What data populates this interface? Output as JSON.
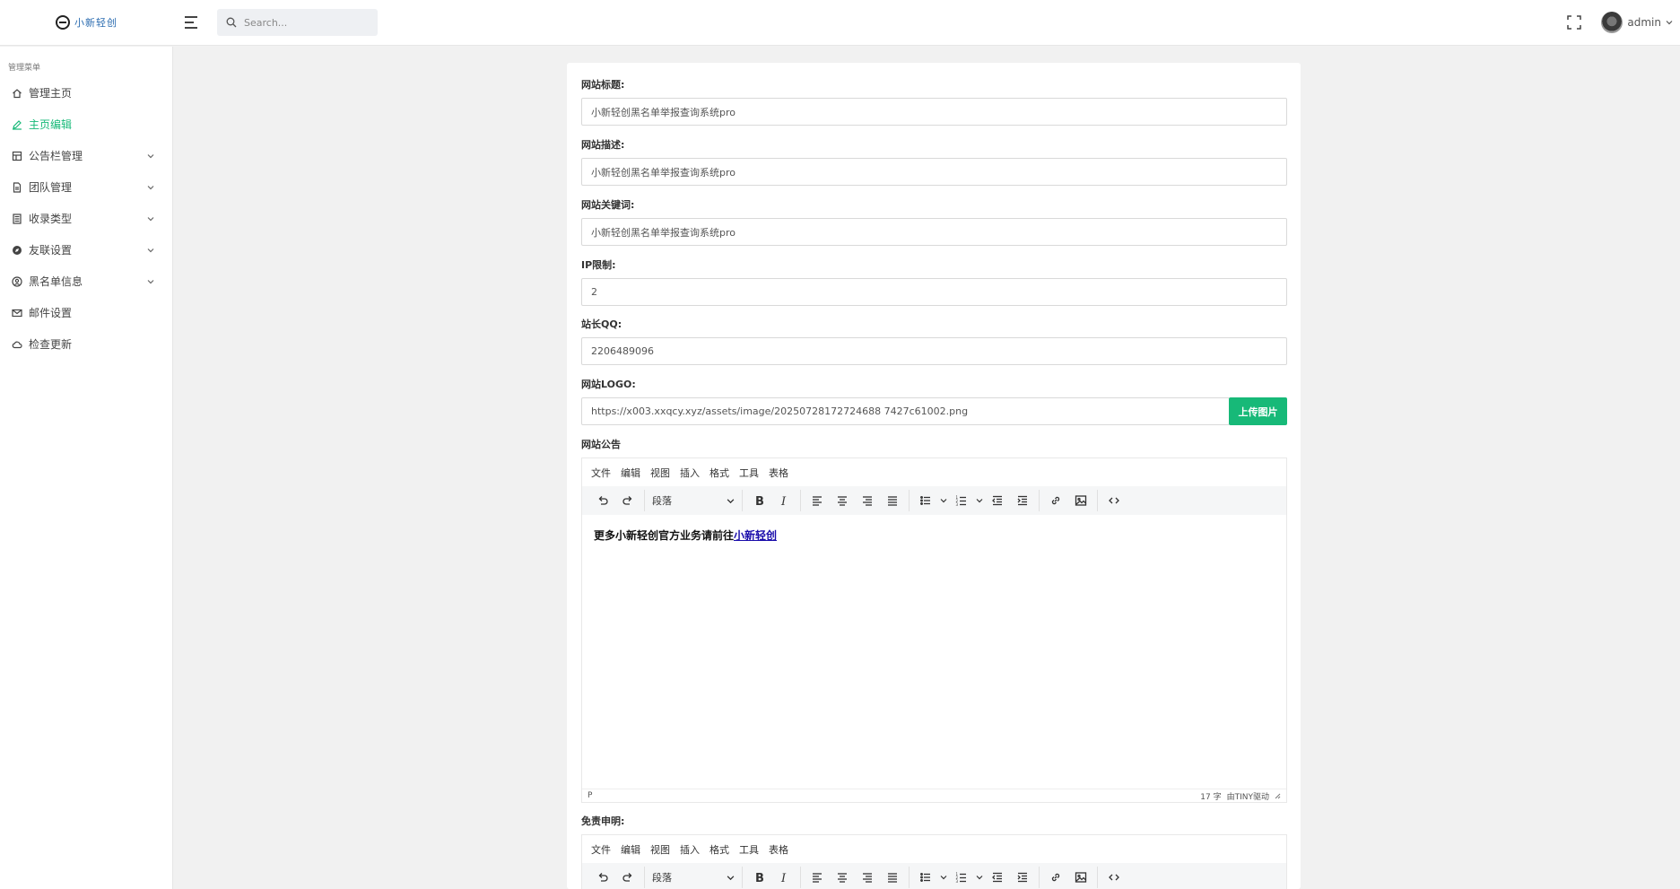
{
  "header": {
    "brand_text": "小新轻创",
    "search_placeholder": "Search...",
    "username": "admin"
  },
  "sidebar": {
    "title": "管理菜单",
    "items": [
      {
        "label": "管理主页",
        "icon": "home-icon",
        "active": false,
        "has_children": false
      },
      {
        "label": "主页编辑",
        "icon": "edit-icon",
        "active": true,
        "has_children": false
      },
      {
        "label": "公告栏管理",
        "icon": "layout-icon",
        "active": false,
        "has_children": true
      },
      {
        "label": "团队管理",
        "icon": "document-icon",
        "active": false,
        "has_children": true
      },
      {
        "label": "收录类型",
        "icon": "calculator-icon",
        "active": false,
        "has_children": true
      },
      {
        "label": "友联设置",
        "icon": "compass-icon",
        "active": false,
        "has_children": true
      },
      {
        "label": "黑名单信息",
        "icon": "location-icon",
        "active": false,
        "has_children": true
      },
      {
        "label": "邮件设置",
        "icon": "mail-icon",
        "active": false,
        "has_children": false
      },
      {
        "label": "检查更新",
        "icon": "cloud-icon",
        "active": false,
        "has_children": false
      }
    ]
  },
  "form": {
    "site_title_label": "网站标题:",
    "site_title_value": "小新轻创黑名单举报查询系统pro",
    "site_desc_label": "网站描述:",
    "site_desc_value": "小新轻创黑名单举报查询系统pro",
    "site_keywords_label": "网站关键词:",
    "site_keywords_value": "小新轻创黑名单举报查询系统pro",
    "ip_limit_label": "IP限制:",
    "ip_limit_value": "2",
    "owner_qq_label": "站长QQ:",
    "owner_qq_value": "2206489096",
    "logo_label": "网站LOGO:",
    "logo_value": "https://x003.xxqcy.xyz/assets/image/20250728172724688 7427c61002.png",
    "upload_label": "上传图片",
    "notice_label": "网站公告",
    "disclaimer_label": "免责申明:"
  },
  "editor": {
    "menus": [
      "文件",
      "编辑",
      "视图",
      "插入",
      "格式",
      "工具",
      "表格"
    ],
    "block_format": "段落",
    "notice_text": "更多小新轻创官方业务请前往",
    "notice_link": "小新轻创",
    "path": "P",
    "word_count": "17 字",
    "powered_by": "由TINY驱动"
  },
  "colors": {
    "accent": "#17b978",
    "link": "#1a0dab"
  }
}
